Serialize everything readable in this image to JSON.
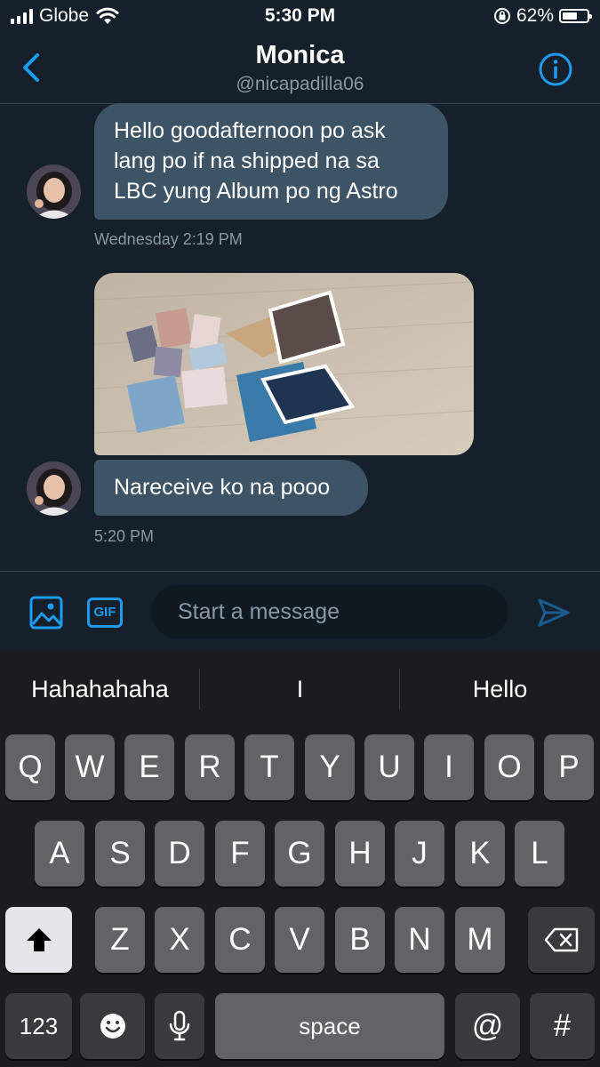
{
  "status_bar": {
    "carrier": "Globe",
    "time": "5:30 PM",
    "battery": "62%",
    "battery_level": 0.62
  },
  "header": {
    "name": "Monica",
    "handle": "@nicapadilla06"
  },
  "messages": [
    {
      "text": "Hello goodafternoon po ask lang po if na shipped na sa LBC yung Album po ng Astro",
      "timestamp": "Wednesday 2:19 PM"
    },
    {
      "text": "Nareceive ko na pooo",
      "timestamp": "5:20 PM"
    }
  ],
  "compose": {
    "placeholder": "Start a message",
    "gif_label": "GIF"
  },
  "keyboard": {
    "suggestions": [
      "Hahahahaha",
      "I",
      "Hello"
    ],
    "row1": [
      "Q",
      "W",
      "E",
      "R",
      "T",
      "Y",
      "U",
      "I",
      "O",
      "P"
    ],
    "row2": [
      "A",
      "S",
      "D",
      "F",
      "G",
      "H",
      "J",
      "K",
      "L"
    ],
    "row3": [
      "Z",
      "X",
      "C",
      "V",
      "B",
      "N",
      "M"
    ],
    "numbers_label": "123",
    "space_label": "space",
    "at_label": "@",
    "hash_label": "#"
  },
  "icons": {
    "back": "chevron-left-icon",
    "info": "info-icon",
    "media": "image-icon",
    "send": "send-icon",
    "shift": "shift-icon",
    "delete": "backspace-icon",
    "emoji": "emoji-icon",
    "mic": "microphone-icon"
  },
  "colors": {
    "background": "#15202b",
    "accent": "#1d9bf0",
    "bubble": "#3d5466",
    "keyboard": "#1c1c1e"
  }
}
